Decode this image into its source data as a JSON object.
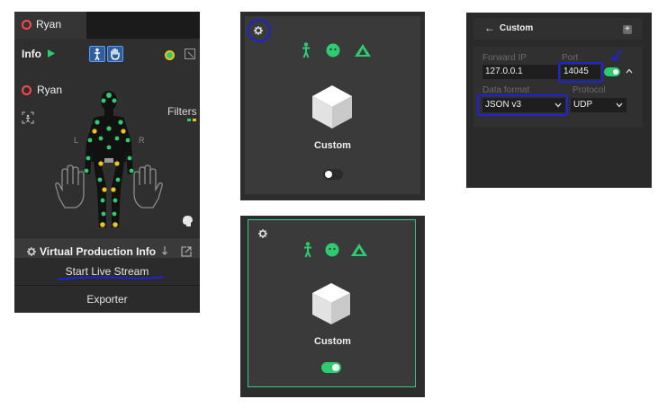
{
  "left_panel": {
    "tab_name": "Ryan",
    "info_label": "Info",
    "actor_name": "Ryan",
    "filters_label": "Filters",
    "hand_left_letter": "L",
    "hand_right_letter": "R",
    "vp_info_label": "Virtual Production Info",
    "start_stream_label": "Start Live Stream",
    "exporter_label": "Exporter"
  },
  "card_top": {
    "cube_label": "Custom",
    "toggle_on": false
  },
  "card_bottom": {
    "cube_label": "Custom",
    "toggle_on": true
  },
  "custom_panel": {
    "title": "Custom",
    "back_arrow": "←",
    "forward_ip_label": "Forward IP",
    "forward_ip_value": "127.0.0.1",
    "port_label": "Port",
    "port_value": "14045",
    "data_format_label": "Data format",
    "data_format_value": "JSON v3",
    "protocol_label": "Protocol",
    "protocol_value": "UDP",
    "stream_toggle_on": true
  },
  "colors": {
    "accent_green": "#2ecc71",
    "teal_green": "#3ec38a",
    "annotation_blue": "#1e22d8",
    "marker_yellow": "#f0c419",
    "marker_green": "#2ecc71"
  },
  "icons": [
    "record-icon",
    "play-icon",
    "body-icon",
    "hand-icon",
    "record-dot-icon",
    "expand-icon",
    "settings-icon",
    "body-small-icon",
    "face-icon",
    "prop-icon",
    "download-icon",
    "external-link-icon",
    "back-arrow-icon",
    "add-icon",
    "chevron-down-icon",
    "chevron-up-icon",
    "check-mark-annotation"
  ]
}
